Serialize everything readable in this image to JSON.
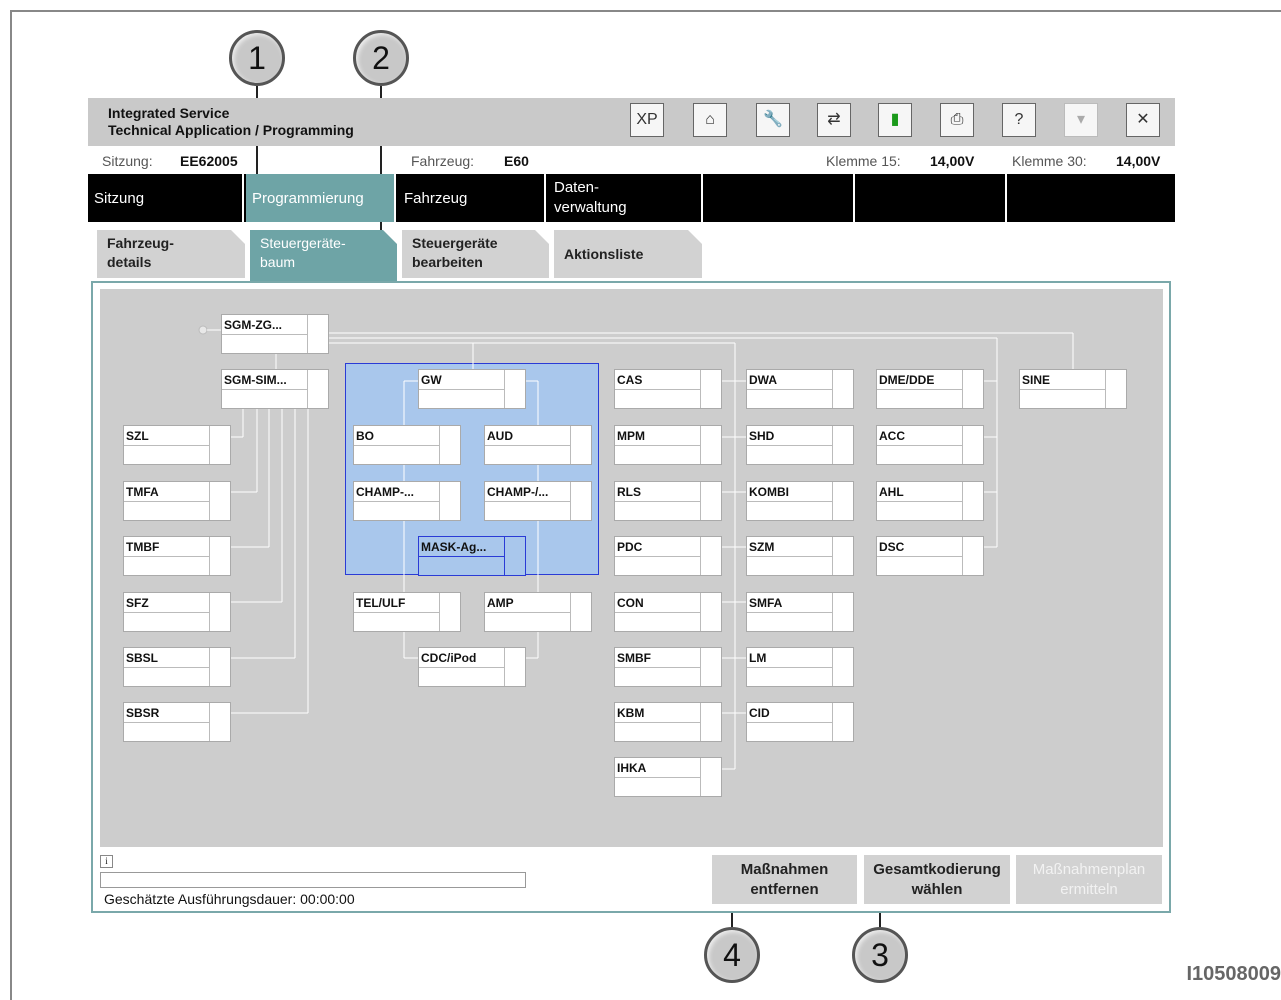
{
  "callouts": [
    "1",
    "2",
    "3",
    "4"
  ],
  "app": {
    "title_line1": "Integrated Service",
    "title_line2": "Technical Application / Programming"
  },
  "toolbar": [
    {
      "icon": "xp-icon",
      "label": "XP"
    },
    {
      "icon": "home-icon",
      "label": "⌂"
    },
    {
      "icon": "wrench-icon",
      "label": "🔧"
    },
    {
      "icon": "swap-icon",
      "label": "⇄"
    },
    {
      "icon": "battery-icon",
      "label": "▮"
    },
    {
      "icon": "print-icon",
      "label": "⎙"
    },
    {
      "icon": "help-icon",
      "label": "?"
    },
    {
      "icon": "minimize-icon",
      "label": "▾"
    },
    {
      "icon": "close-icon",
      "label": "✕"
    }
  ],
  "info": {
    "sitzung_label": "Sitzung:",
    "sitzung_value": "EE62005",
    "fahrzeug_label": "Fahrzeug:",
    "fahrzeug_value": "E60",
    "kl15_label": "Klemme 15:",
    "kl15_value": "14,00V",
    "kl30_label": "Klemme 30:",
    "kl30_value": "14,00V"
  },
  "nav": [
    "Sitzung",
    "Programmierung",
    "Fahrzeug",
    "Daten-\nverwaltung"
  ],
  "subtabs": [
    "Fahrzeug-\ndetails",
    "Steuergeräte-\nbaum",
    "Steuergeräte\nbearbeiten",
    "Aktionsliste"
  ],
  "ecus": {
    "sgm_zg": "SGM-ZG...",
    "sgm_sim": "SGM-SIM...",
    "szl": "SZL",
    "tmfa": "TMFA",
    "tmbf": "TMBF",
    "sfz": "SFZ",
    "sbsl": "SBSL",
    "sbsr": "SBSR",
    "gw": "GW",
    "bo": "BO",
    "aud": "AUD",
    "champ1": "CHAMP-...",
    "champ2": "CHAMP-/...",
    "mask": "MASK-Ag...",
    "tel": "TEL/ULF",
    "amp": "AMP",
    "cdc": "CDC/iPod",
    "cas": "CAS",
    "mpm": "MPM",
    "rls": "RLS",
    "pdc": "PDC",
    "con": "CON",
    "smbf": "SMBF",
    "kbm": "KBM",
    "ihka": "IHKA",
    "dwa": "DWA",
    "shd": "SHD",
    "kombi": "KOMBI",
    "szm": "SZM",
    "smfa": "SMFA",
    "lm": "LM",
    "cid": "CID",
    "dme": "DME/DDE",
    "acc": "ACC",
    "ahl": "AHL",
    "dsc": "DSC",
    "sine": "SINE"
  },
  "status": {
    "info_icon": "i",
    "duration": "Geschätzte Ausführungsdauer: 00:00:00"
  },
  "buttons": {
    "remove": "Maßnahmen\nentfernen",
    "coding": "Gesamtkodierung\nwählen",
    "plan": "Maßnahmenplan\nermitteln"
  },
  "doc_id": "I10508009"
}
